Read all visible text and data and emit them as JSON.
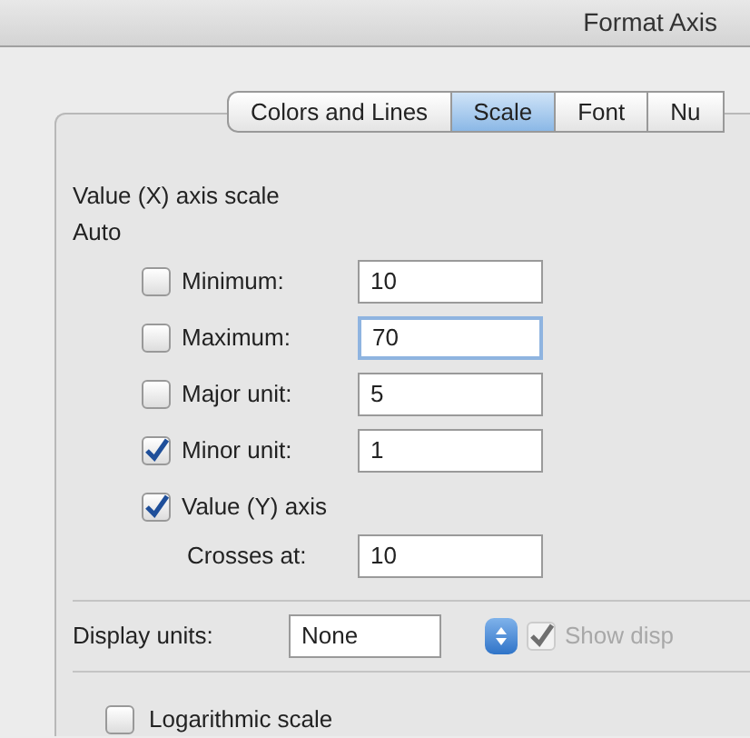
{
  "window": {
    "title": "Format Axis"
  },
  "tabs": [
    {
      "label": "Colors and Lines",
      "selected": false
    },
    {
      "label": "Scale",
      "selected": true
    },
    {
      "label": "Font",
      "selected": false
    },
    {
      "label": "Nu",
      "selected": false
    }
  ],
  "scale": {
    "heading": "Value (X) axis scale",
    "subheading": "Auto",
    "rows": [
      {
        "kind": "checkbox-field",
        "label": "Minimum:",
        "checked": false,
        "value": "10",
        "focused": false
      },
      {
        "kind": "checkbox-field",
        "label": "Maximum:",
        "checked": false,
        "value": "70",
        "focused": true
      },
      {
        "kind": "checkbox-field",
        "label": "Major unit:",
        "checked": false,
        "value": "5",
        "focused": false
      },
      {
        "kind": "checkbox-field",
        "label": "Minor unit:",
        "checked": true,
        "value": "1",
        "focused": false
      },
      {
        "kind": "checkbox",
        "label": "Value (Y) axis",
        "checked": true
      },
      {
        "kind": "field",
        "label": "Crosses at:",
        "value": "10",
        "focused": false
      }
    ]
  },
  "display_units": {
    "label": "Display units:",
    "value": "None",
    "show_label": {
      "label": "Show disp",
      "checked": true,
      "disabled": true
    }
  },
  "logarithmic": {
    "label": "Logarithmic scale",
    "checked": false
  }
}
